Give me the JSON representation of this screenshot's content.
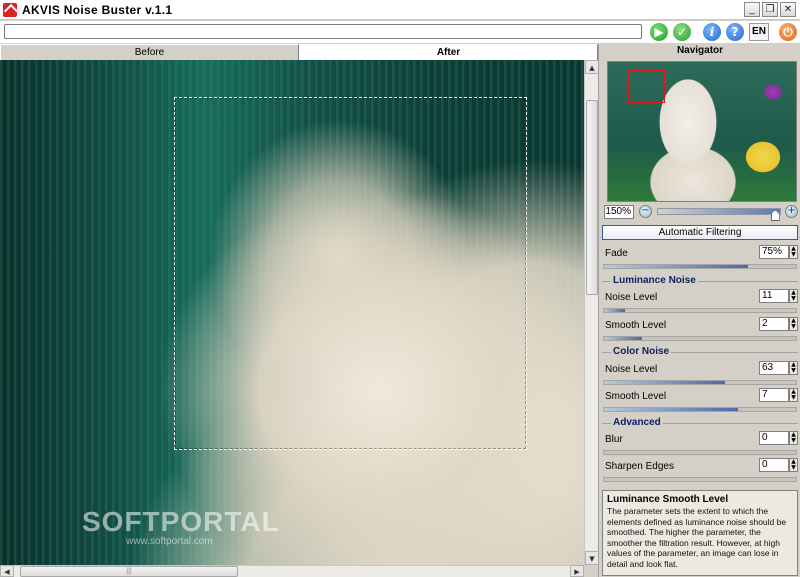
{
  "window": {
    "title": "AKVIS Noise Buster v.1.1",
    "controls": [
      "_",
      "❐",
      "✕"
    ]
  },
  "toolbar": {
    "progress_fraction": 0,
    "language": "EN",
    "icons": [
      "run-icon",
      "apply-icon",
      "info-icon",
      "help-icon",
      "power-icon"
    ]
  },
  "tabs": [
    {
      "label": "Before",
      "active": false
    },
    {
      "label": "After",
      "active": true
    }
  ],
  "watermark": {
    "logo": "SOFTPORTAL",
    "url": "www.softportal.com"
  },
  "navigator": {
    "title": "Navigator",
    "zoom": "150%",
    "zoom_slider_fraction": 0.95
  },
  "panel": {
    "auto_button": "Automatic Filtering",
    "fade": {
      "label": "Fade",
      "value": "75%",
      "fraction": 0.75
    },
    "groups": {
      "luminance": "Luminance Noise",
      "color": "Color Noise",
      "advanced": "Advanced"
    },
    "luminance_noise_level": {
      "label": "Noise Level",
      "value": "11",
      "fraction": 0.11
    },
    "luminance_smooth_level": {
      "label": "Smooth Level",
      "value": "2",
      "fraction": 0.2
    },
    "color_noise_level": {
      "label": "Noise Level",
      "value": "63",
      "fraction": 0.63
    },
    "color_smooth_level": {
      "label": "Smooth Level",
      "value": "7",
      "fraction": 0.7
    },
    "blur": {
      "label": "Blur",
      "value": "0",
      "fraction": 0
    },
    "sharpen": {
      "label": "Sharpen Edges",
      "value": "0",
      "fraction": 0
    }
  },
  "help": {
    "title": "Luminance Smooth Level",
    "text": "The parameter sets the extent to which the elements defined as luminance noise should be smoothed. The higher the parameter, the smoother the filtration result. However, at high values of the parameter, an image can lose in detail and look flat."
  },
  "colors": {
    "accent": "#3b7bd9",
    "navigator_rect": "#e01a1a"
  }
}
